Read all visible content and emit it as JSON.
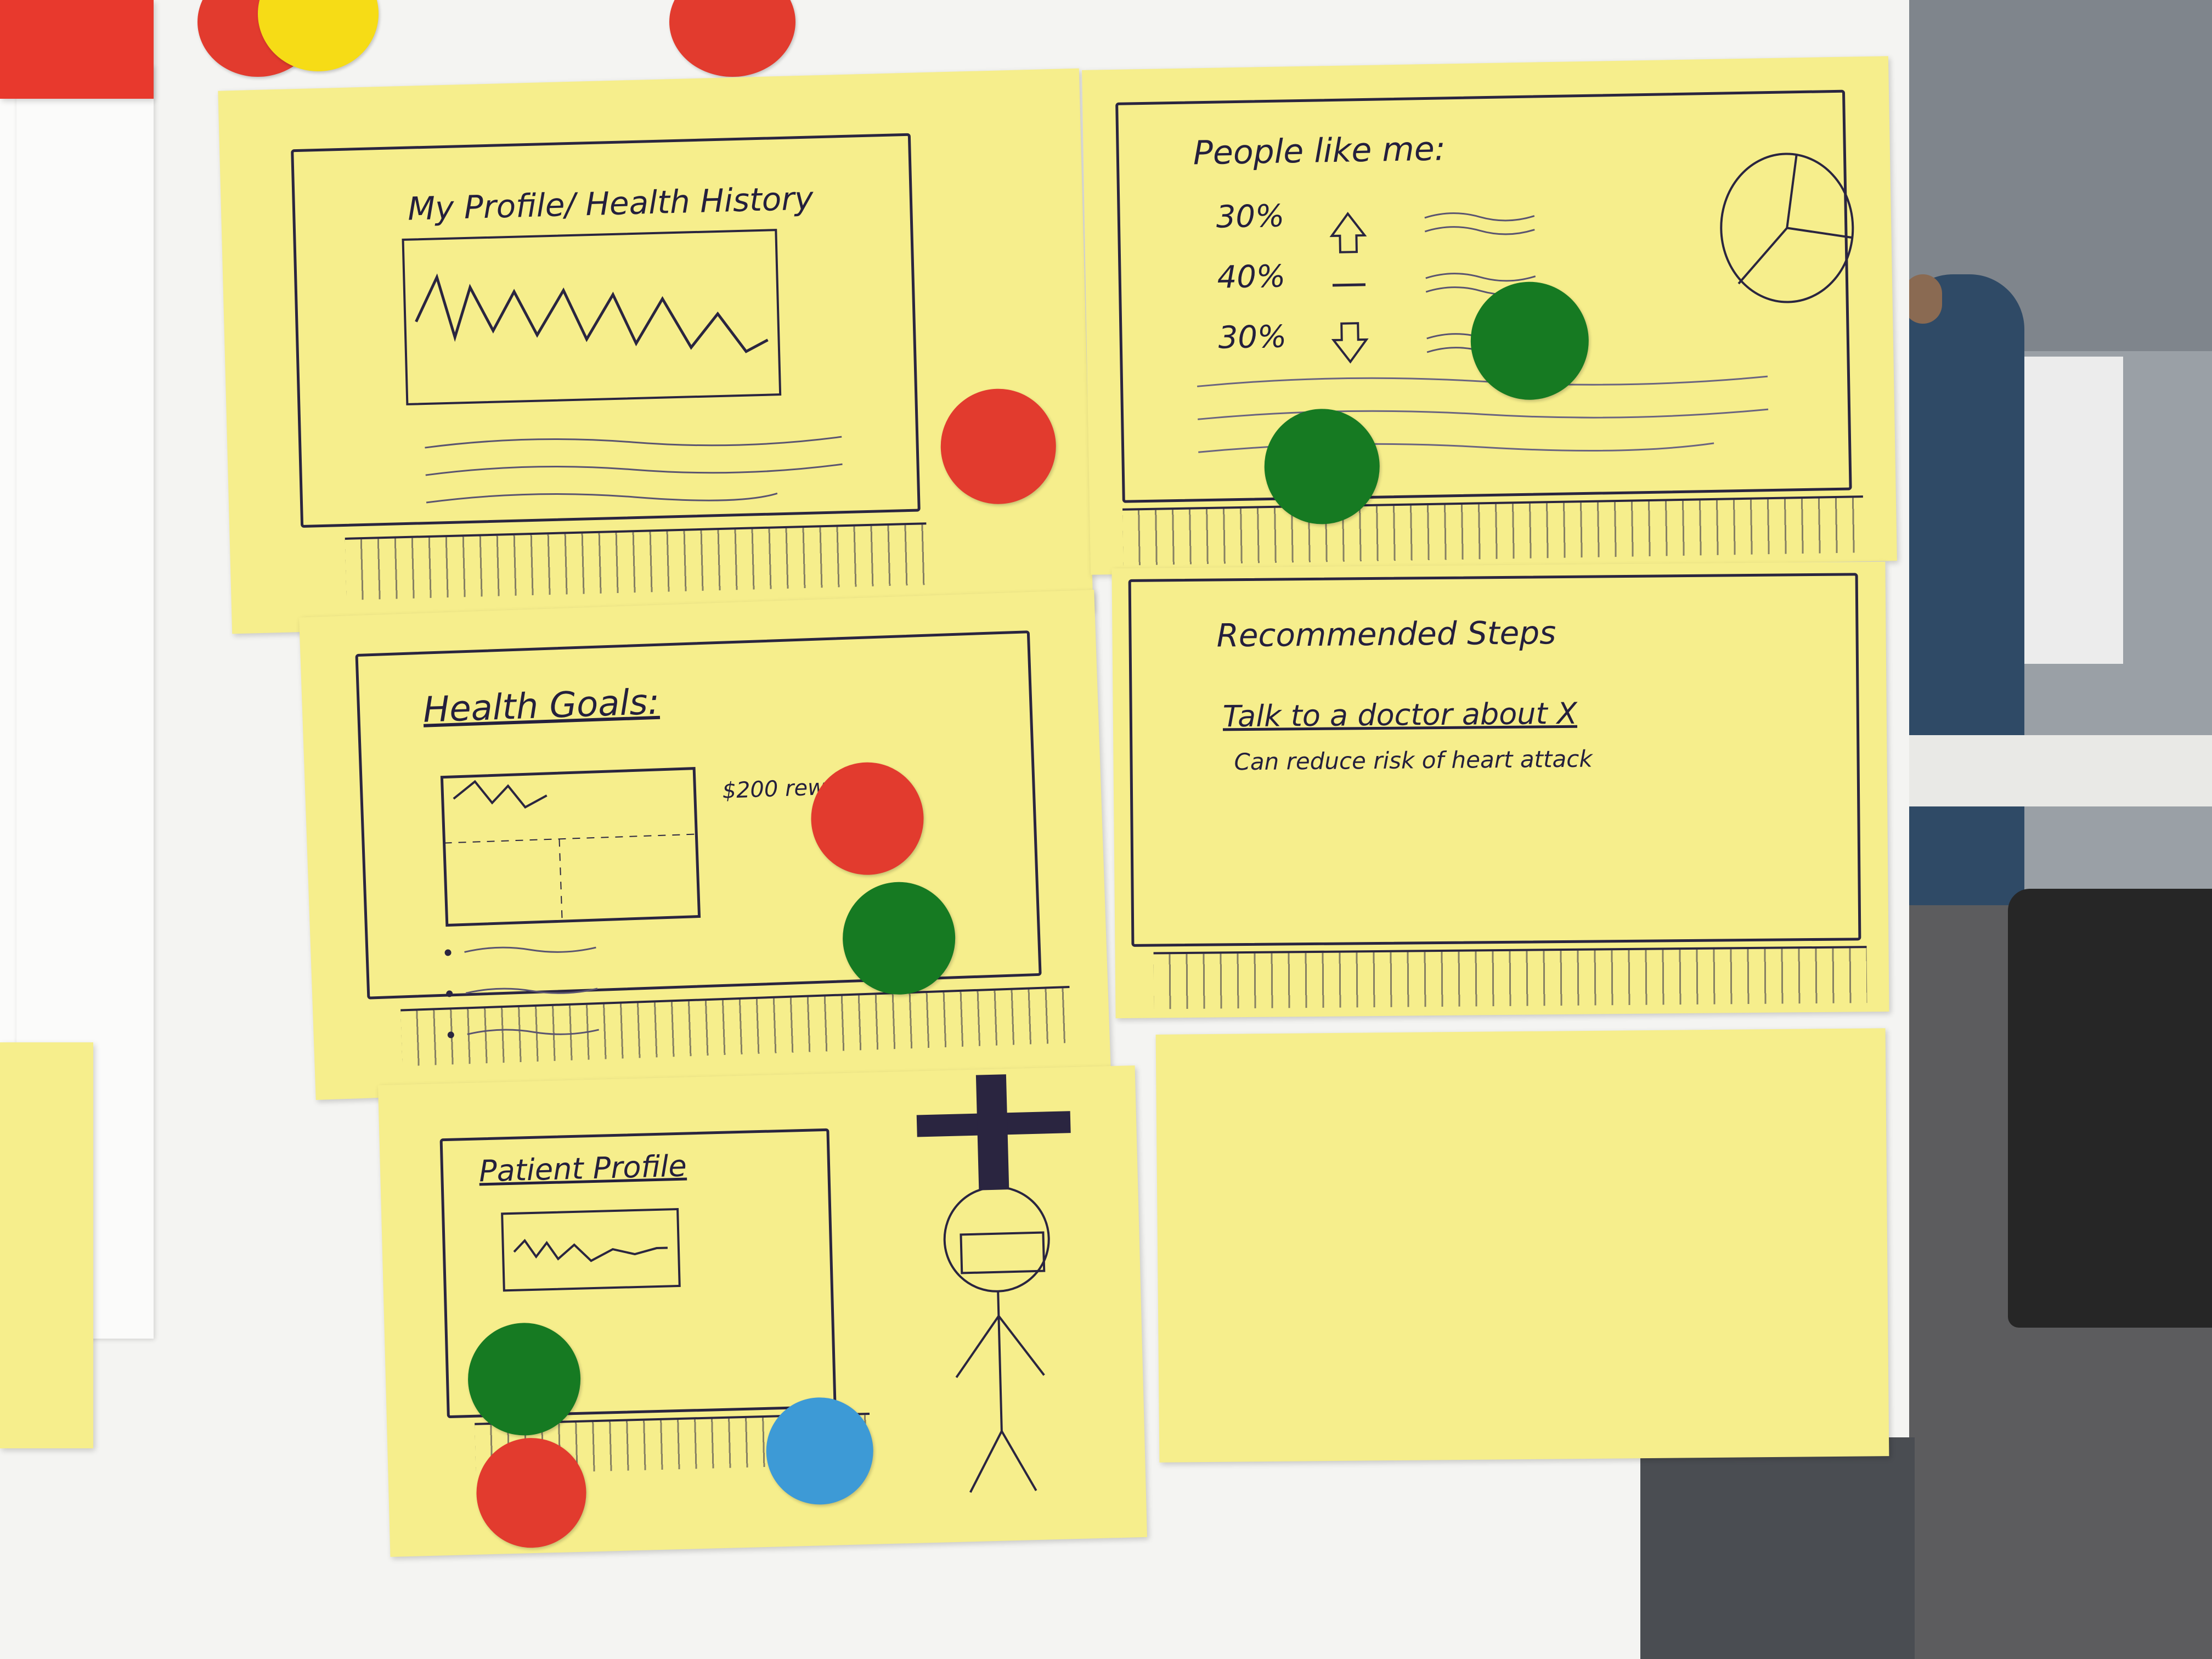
{
  "note_profile": {
    "title": "My Profile/ Health History"
  },
  "note_people": {
    "title": "People like me:",
    "rows": [
      {
        "pct": "30%",
        "arrow": "up-arrow"
      },
      {
        "pct": "40%",
        "arrow": "dash"
      },
      {
        "pct": "30%",
        "arrow": "down-arrow"
      }
    ]
  },
  "note_goals": {
    "title": "Health Goals:",
    "reward": "$200 rew"
  },
  "note_steps": {
    "title": "Recommended Steps",
    "bullets": [
      "Talk to a doctor about X",
      "Can reduce risk of heart attack"
    ]
  },
  "note_patient": {
    "title": "Patient Profile"
  },
  "colors": {
    "sticky": "#f6ee8c",
    "red_dot": "#e23b2e",
    "green_dot": "#167a22",
    "blue_dot": "#3d9ad6",
    "yellow_dot": "#f6dc16",
    "ink": "#241f3d"
  }
}
